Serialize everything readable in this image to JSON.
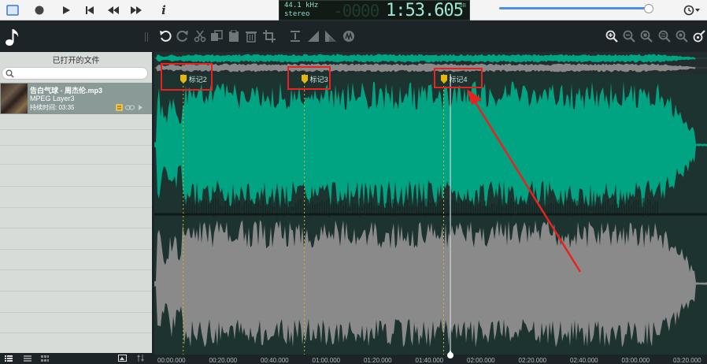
{
  "transport": {
    "sample_rate": "44.1 kHz",
    "channels": "stereo",
    "ghost_digits": "-0000",
    "time": "1:53.605",
    "db_label": "dB",
    "volume": 0.97
  },
  "toolbar": {
    "logo_icon": "music-note-icon",
    "edit_tools": [
      "undo-icon",
      "redo-icon",
      "cut-icon",
      "copy-icon",
      "paste-icon",
      "delete-icon",
      "crop-icon"
    ],
    "effect_tools": [
      "normalize-icon",
      "fade-in-icon",
      "fade-out-icon",
      "effect-icon"
    ],
    "zoom_tools": [
      "zoom-in-icon",
      "zoom-out-icon",
      "zoom-selection-icon",
      "zoom-fit-icon",
      "zoom-full-icon",
      "zoom-settings-icon"
    ]
  },
  "sidebar": {
    "title": "已打开的文件",
    "search_placeholder": "",
    "file": {
      "name": "告白气球 - 周杰伦.mp3",
      "type": "MPEG Layer3",
      "duration": "持续时间: 03:35"
    }
  },
  "markers": [
    {
      "label": "标记2",
      "time": "00:10"
    },
    {
      "label": "标记3",
      "time": "00:57"
    },
    {
      "label": "标记4",
      "time": "01:51"
    }
  ],
  "timeline": {
    "ticks": [
      "00:00.000",
      "00:20.000",
      "00:40.000",
      "01:00.000",
      "01:20.000",
      "01:40.000",
      "02:00.000",
      "02:20.000",
      "02:40.000",
      "03:00.000",
      "03:20.000"
    ]
  },
  "colors": {
    "top_channel": "#00a482",
    "bottom_channel": "#8a8a8a",
    "annotation": "#e8231f",
    "marker": "#e8b70c"
  }
}
